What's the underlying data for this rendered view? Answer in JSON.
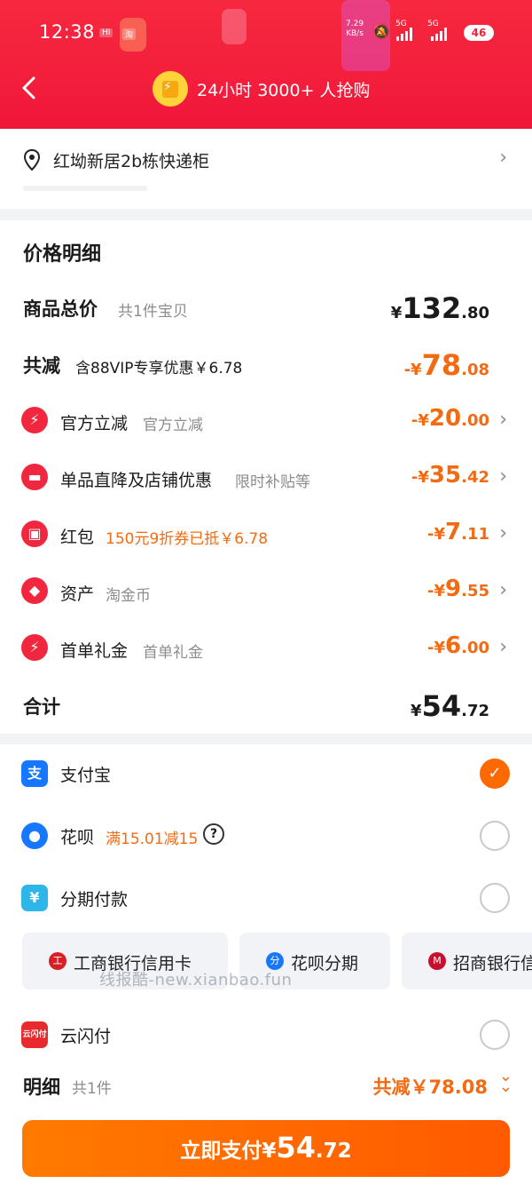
{
  "status_bar": {
    "time": "12:38",
    "mini_1": "HI",
    "mini_2": "淘",
    "net_speed": "7.29",
    "net_unit": "KB/s",
    "sig1": "5G",
    "sig2": "5G",
    "battery": "46"
  },
  "header": {
    "title": "24小时 3000+ 人抢购",
    "back_icon": "chevron-left-icon",
    "badge_icon": "shopping-bag-bolt-icon"
  },
  "address": {
    "text": "红坳新居2b栋快递柜",
    "icon": "location-pin-icon"
  },
  "price_detail": {
    "title": "价格明细",
    "total": {
      "label": "商品总价",
      "sub": "共1件宝贝",
      "cur": "¥",
      "int": "132",
      "dec": ".80"
    },
    "reduce": {
      "label": "共减",
      "sub": "含88VIP专享优惠￥6.78",
      "cur": "-¥",
      "int": "78",
      "dec": ".08"
    },
    "items": [
      {
        "label": "官方立减",
        "sub": "官方立减",
        "cur": "-¥",
        "int": "20",
        "dec": ".00",
        "icon": "bolt-icon"
      },
      {
        "label": "单品直降及店铺优惠",
        "sub": "限时补贴等",
        "cur": "-¥",
        "int": "35",
        "dec": ".42",
        "icon": "shop-icon"
      },
      {
        "label": "红包",
        "sub": "150元9折券已抵￥6.78",
        "cur": "-¥",
        "int": "7",
        "dec": ".11",
        "icon": "red-packet-icon"
      },
      {
        "label": "资产",
        "sub": "淘金币",
        "cur": "-¥",
        "int": "9",
        "dec": ".55",
        "icon": "tag-icon"
      },
      {
        "label": "首单礼金",
        "sub": "首单礼金",
        "cur": "-¥",
        "int": "6",
        "dec": ".00",
        "icon": "bolt-icon"
      }
    ],
    "sum": {
      "label": "合计",
      "cur": "¥",
      "int": "54",
      "dec": ".72"
    }
  },
  "payment": {
    "alipay": {
      "label": "支付宝",
      "selected": true
    },
    "huabei": {
      "label": "花呗",
      "promo": "满15.01减15"
    },
    "installment": {
      "label": "分期付款"
    },
    "cards": [
      {
        "label": "工商银行信用卡"
      },
      {
        "label": "花呗分期"
      },
      {
        "label": "招商银行信"
      }
    ],
    "unionpay": {
      "label": "云闪付"
    }
  },
  "watermark": "线报酷-new.xianbao.fun",
  "detail_bar": {
    "label": "明细",
    "count": "共1件",
    "reduce": "共减￥78.08"
  },
  "pay_button": {
    "label": "立即支付",
    "cur": "¥",
    "int": "54",
    "dec": ".72"
  },
  "colors": {
    "header_red": "#f31f3c",
    "accent_orange": "#f26b12",
    "button_orange": "#ff6a00",
    "alipay_blue": "#1677ff"
  }
}
